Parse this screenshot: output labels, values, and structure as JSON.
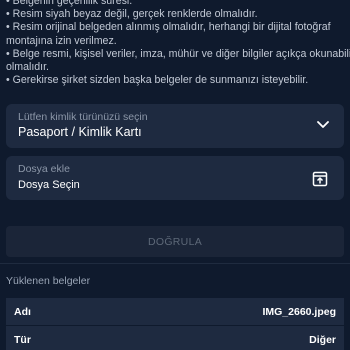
{
  "requirements": {
    "lines": [
      "• Belgenin geçerlilik süresi.",
      "• Resim siyah beyaz değil, gerçek renklerde olmalıdır.",
      "• Resim orijinal belgeden alınmış olmalıdır, herhangi bir dijital fotoğraf",
      "montajına izin verilmez.",
      "• Belge resmi, kişisel veriler, imza, mühür ve diğer bilgiler açıkça okunabilir",
      "olmalıdır.",
      "• Gerekirse şirket sizden başka belgeler de sunmanızı isteyebilir."
    ]
  },
  "id_type": {
    "label": "Lütfen kimlik türünüzü seçin",
    "value": "Pasaport / Kimlik Kartı",
    "icon": "chevron-down-icon"
  },
  "file": {
    "label": "Dosya ekle",
    "value": "Dosya Seçin",
    "icon": "upload-icon"
  },
  "verify_button": {
    "label": "DOĞRULA"
  },
  "uploaded": {
    "title": "Yüklenen belgeler",
    "rows": [
      {
        "key": "Adı",
        "value": "IMG_2660.jpeg"
      },
      {
        "key": "Tür",
        "value": "Diğer"
      }
    ]
  },
  "colors": {
    "background": "#0f1a2d",
    "field": "#1e2a40",
    "button_disabled_text": "#5d6878"
  }
}
